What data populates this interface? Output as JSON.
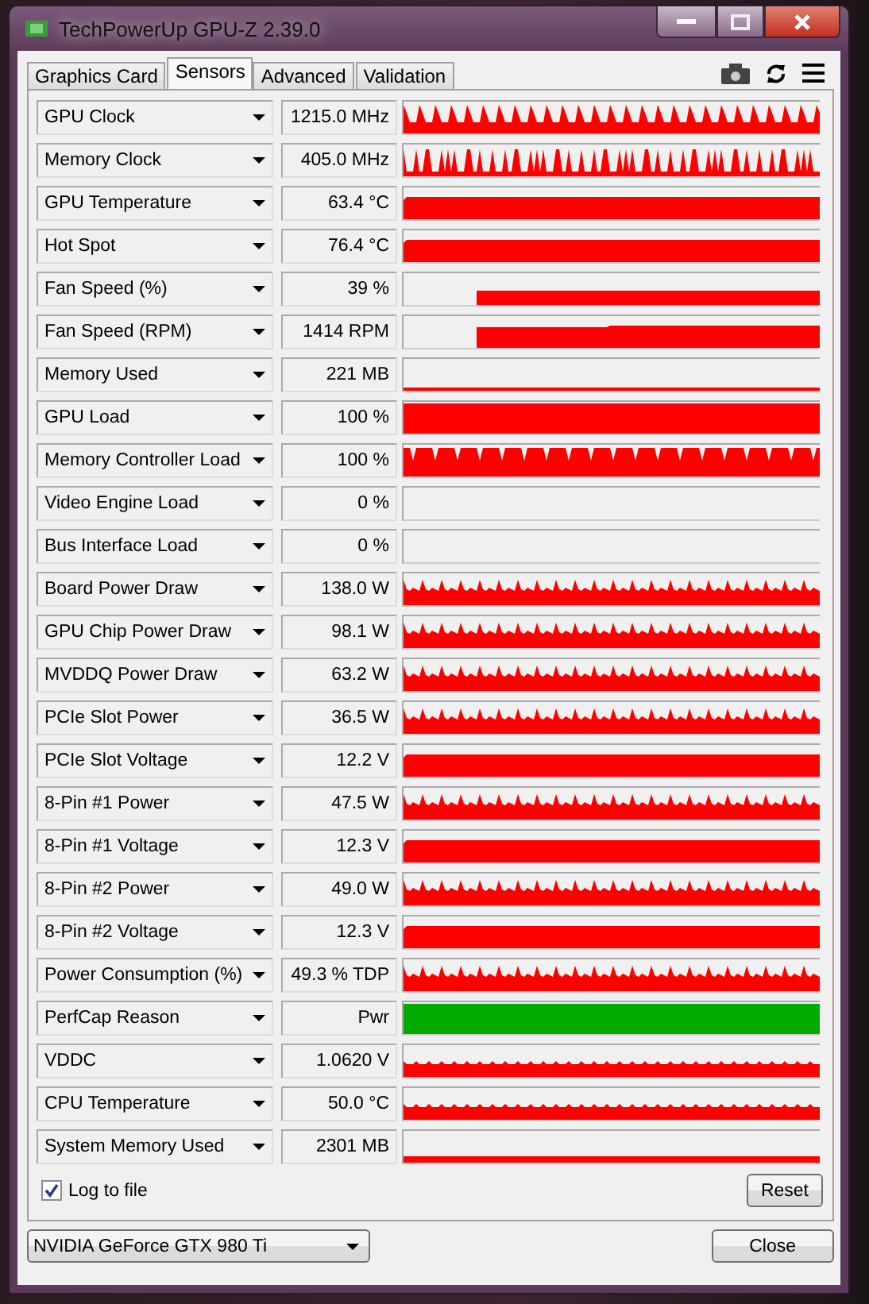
{
  "window": {
    "title": "TechPowerUp GPU-Z 2.39.0"
  },
  "tabs": [
    {
      "label": "Graphics Card",
      "selected": false
    },
    {
      "label": "Sensors",
      "selected": true
    },
    {
      "label": "Advanced",
      "selected": false
    },
    {
      "label": "Validation",
      "selected": false
    }
  ],
  "sensors": [
    {
      "name": "GPU Clock",
      "value": "1215.0 MHz",
      "kind": "spiky",
      "color": "#ff0000"
    },
    {
      "name": "Memory Clock",
      "value": "405.0 MHz",
      "kind": "bars",
      "color": "#ff0000"
    },
    {
      "name": "GPU Temperature",
      "value": "63.4 °C",
      "kind": "solid",
      "color": "#ff0000"
    },
    {
      "name": "Hot Spot",
      "value": "76.4 °C",
      "kind": "solid",
      "color": "#ff0000"
    },
    {
      "name": "Fan Speed (%)",
      "value": "39 %",
      "kind": "late-thin",
      "color": "#ff0000"
    },
    {
      "name": "Fan Speed (RPM)",
      "value": "1414 RPM",
      "kind": "late",
      "color": "#ff0000"
    },
    {
      "name": "Memory Used",
      "value": "221 MB",
      "kind": "line",
      "color": "#ff0000"
    },
    {
      "name": "GPU Load",
      "value": "100 %",
      "kind": "full",
      "color": "#ff0000"
    },
    {
      "name": "Memory Controller Load",
      "value": "100 %",
      "kind": "dips",
      "color": "#ff0000"
    },
    {
      "name": "Video Engine Load",
      "value": "0 %",
      "kind": "empty"
    },
    {
      "name": "Bus Interface Load",
      "value": "0 %",
      "kind": "empty"
    },
    {
      "name": "Board Power Draw",
      "value": "138.0 W",
      "kind": "wavy",
      "color": "#ff0000"
    },
    {
      "name": "GPU Chip Power Draw",
      "value": "98.1 W",
      "kind": "wavy",
      "color": "#ff0000"
    },
    {
      "name": "MVDDQ Power Draw",
      "value": "63.2 W",
      "kind": "wavy",
      "color": "#ff0000"
    },
    {
      "name": "PCIe Slot Power",
      "value": "36.5 W",
      "kind": "wavy",
      "color": "#ff0000"
    },
    {
      "name": "PCIe Slot Voltage",
      "value": "12.2 V",
      "kind": "solid",
      "color": "#ff0000"
    },
    {
      "name": "8-Pin #1 Power",
      "value": "47.5 W",
      "kind": "wavy",
      "color": "#ff0000"
    },
    {
      "name": "8-Pin #1 Voltage",
      "value": "12.3 V",
      "kind": "solid",
      "color": "#ff0000"
    },
    {
      "name": "8-Pin #2 Power",
      "value": "49.0 W",
      "kind": "wavy",
      "color": "#ff0000"
    },
    {
      "name": "8-Pin #2 Voltage",
      "value": "12.3 V",
      "kind": "solid",
      "color": "#ff0000"
    },
    {
      "name": "Power Consumption (%)",
      "value": "49.3 % TDP",
      "kind": "wavy",
      "color": "#ff0000"
    },
    {
      "name": "PerfCap Reason",
      "value": "Pwr",
      "kind": "full",
      "color": "#00aa00"
    },
    {
      "name": "VDDC",
      "value": "1.0620 V",
      "kind": "low",
      "color": "#ff0000"
    },
    {
      "name": "CPU Temperature",
      "value": "50.0 °C",
      "kind": "low",
      "color": "#ff0000"
    },
    {
      "name": "System Memory Used",
      "value": "2301 MB",
      "kind": "thin",
      "color": "#ff0000"
    }
  ],
  "log_to_file": {
    "label": "Log to file",
    "checked": true
  },
  "reset_button": "Reset",
  "gpu_select": {
    "value": "NVIDIA GeForce GTX 980 Ti"
  },
  "close_button": "Close"
}
